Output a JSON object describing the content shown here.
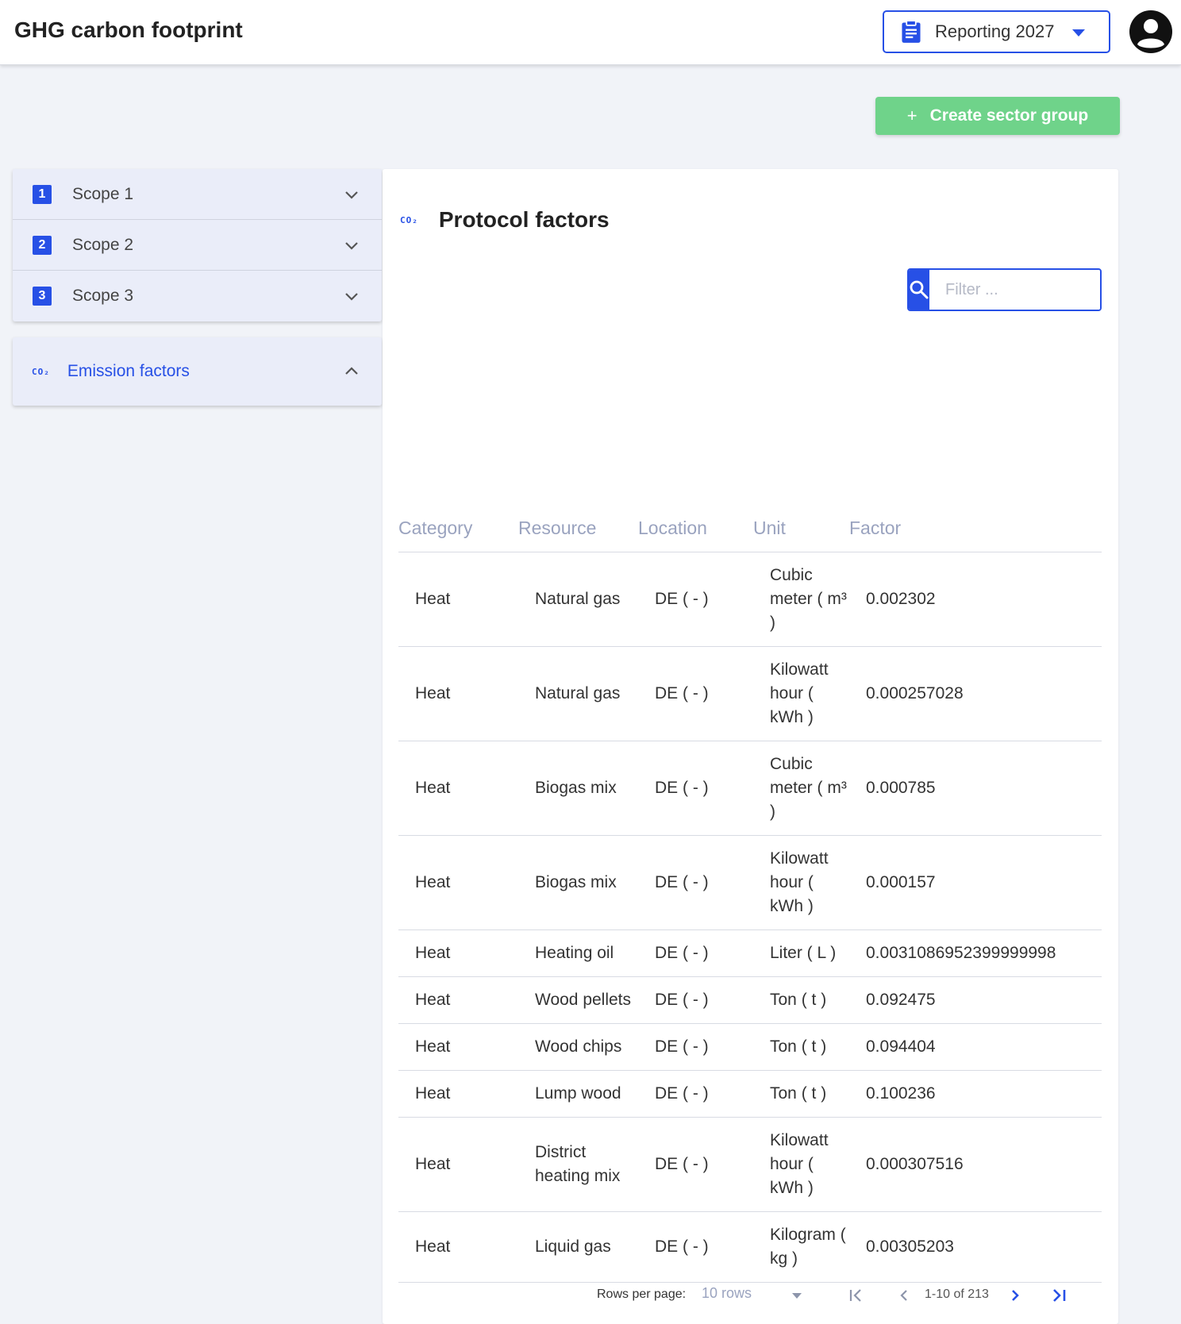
{
  "header": {
    "title": "GHG carbon footprint",
    "reporting_label": "Reporting 2027"
  },
  "actions": {
    "create_label": "Create sector group",
    "create_icon": "+"
  },
  "sidebar": {
    "scopes": [
      {
        "number": "1",
        "label": "Scope 1"
      },
      {
        "number": "2",
        "label": "Scope 2"
      },
      {
        "number": "3",
        "label": "Scope 3"
      }
    ],
    "emission": {
      "icon": "CO₂",
      "label": "Emission factors"
    }
  },
  "main": {
    "icon": "CO₂",
    "title": "Protocol factors",
    "filter_placeholder": "Filter ...",
    "columns": [
      "Category",
      "Resource",
      "Location",
      "Unit",
      "Factor"
    ],
    "rows": [
      [
        "Heat",
        "Natural gas",
        "DE ( - )",
        "Cubic meter ( m³ )",
        "0.002302"
      ],
      [
        "Heat",
        "Natural gas",
        "DE ( - )",
        "Kilowatt hour ( kWh )",
        "0.000257028"
      ],
      [
        "Heat",
        "Biogas mix",
        "DE ( - )",
        "Cubic meter ( m³ )",
        "0.000785"
      ],
      [
        "Heat",
        "Biogas mix",
        "DE ( - )",
        "Kilowatt hour ( kWh )",
        "0.000157"
      ],
      [
        "Heat",
        "Heating oil",
        "DE ( - )",
        "Liter ( L )",
        "0.0031086952399999998"
      ],
      [
        "Heat",
        "Wood pellets",
        "DE ( - )",
        "Ton ( t )",
        "0.092475"
      ],
      [
        "Heat",
        "Wood chips",
        "DE ( - )",
        "Ton ( t )",
        "0.094404"
      ],
      [
        "Heat",
        "Lump wood",
        "DE ( - )",
        "Ton ( t )",
        "0.100236"
      ],
      [
        "Heat",
        "District heating mix",
        "DE ( - )",
        "Kilowatt hour ( kWh )",
        "0.000307516"
      ],
      [
        "Heat",
        "Liquid gas",
        "DE ( - )",
        "Kilogram ( kg )",
        "0.00305203"
      ]
    ]
  },
  "pagination": {
    "rows_per_page_label": "Rows per page:",
    "rows_value": "10 rows",
    "range": "1-10 of 213"
  },
  "colors": {
    "accent": "#2750e6",
    "create_button": "#6fd38a",
    "sidebar_bg": "#eaedf9"
  }
}
